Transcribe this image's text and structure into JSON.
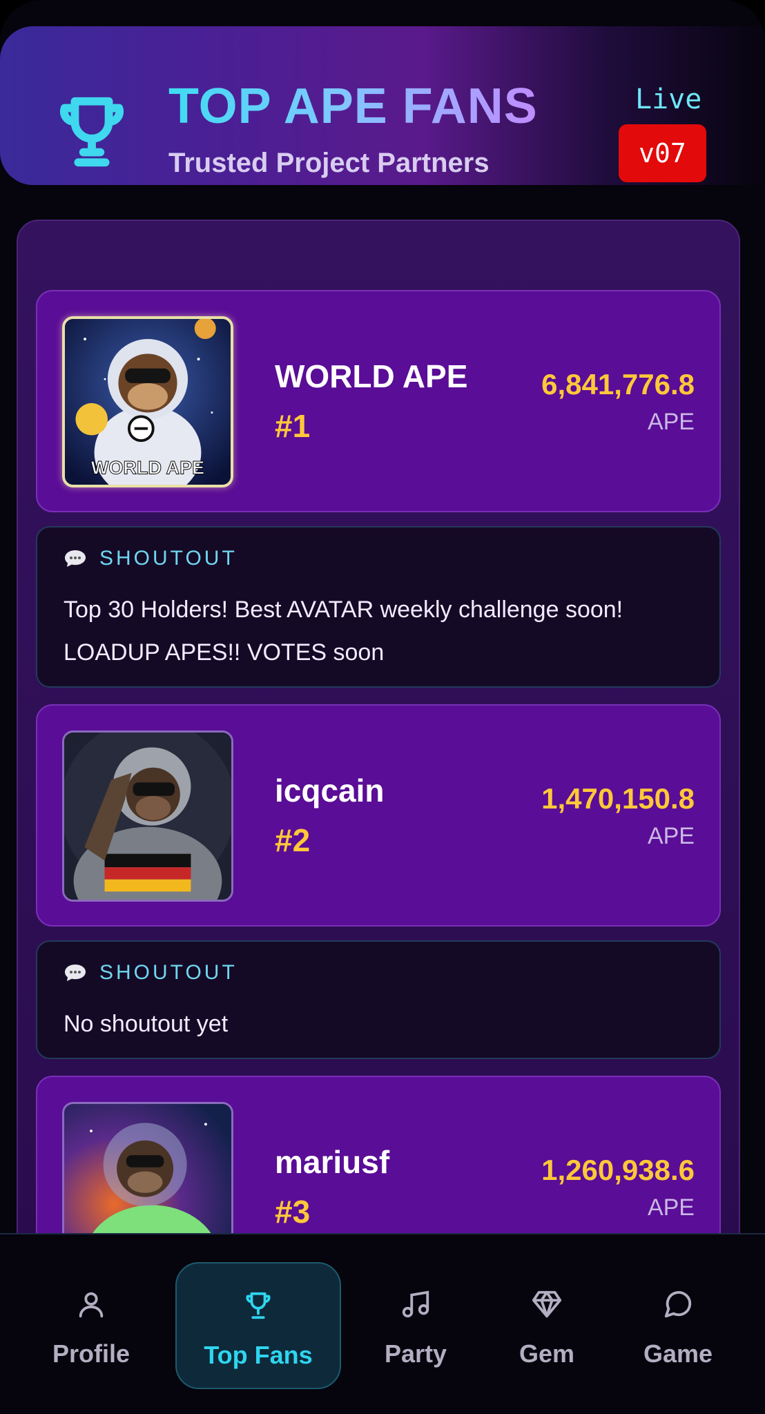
{
  "header": {
    "title": "TOP APE FANS",
    "subtitle": "Trusted Project Partners",
    "status": "Live",
    "version": "v07",
    "icon": "trophy-icon"
  },
  "fans": [
    {
      "name": "WORLD APE",
      "rank": "#1",
      "amount": "6,841,776.8",
      "unit": "APE",
      "avatar_caption": "WORLD APE",
      "avatar": "astronaut-ape-with-moon"
    },
    {
      "name": "icqcain",
      "rank": "#2",
      "amount": "1,470,150.8",
      "unit": "APE",
      "avatar": "saluting-astronaut-ape"
    },
    {
      "name": "mariusf",
      "rank": "#3",
      "amount": "1,260,938.6",
      "unit": "APE",
      "avatar": "green-suit-astronaut-ape"
    }
  ],
  "shoutouts": [
    {
      "label": "SHOUTOUT",
      "lines": [
        "Top 30 Holders! Best AVATAR weekly challenge soon!",
        "LOADUP APES!! VOTES soon"
      ]
    },
    {
      "label": "SHOUTOUT",
      "lines": [
        "No shoutout yet"
      ]
    }
  ],
  "nav": [
    {
      "label": "Profile",
      "icon": "user-icon",
      "active": false
    },
    {
      "label": "Top Fans",
      "icon": "trophy-icon",
      "active": true
    },
    {
      "label": "Party",
      "icon": "music-icon",
      "active": false
    },
    {
      "label": "Gem",
      "icon": "diamond-icon",
      "active": false
    },
    {
      "label": "Game",
      "icon": "chat-icon",
      "active": false
    }
  ],
  "colors": {
    "accent_cyan": "#2fd5ef",
    "gold": "#ffc83a",
    "card_purple": "#5a0d96",
    "version_red": "#e20a0a"
  }
}
